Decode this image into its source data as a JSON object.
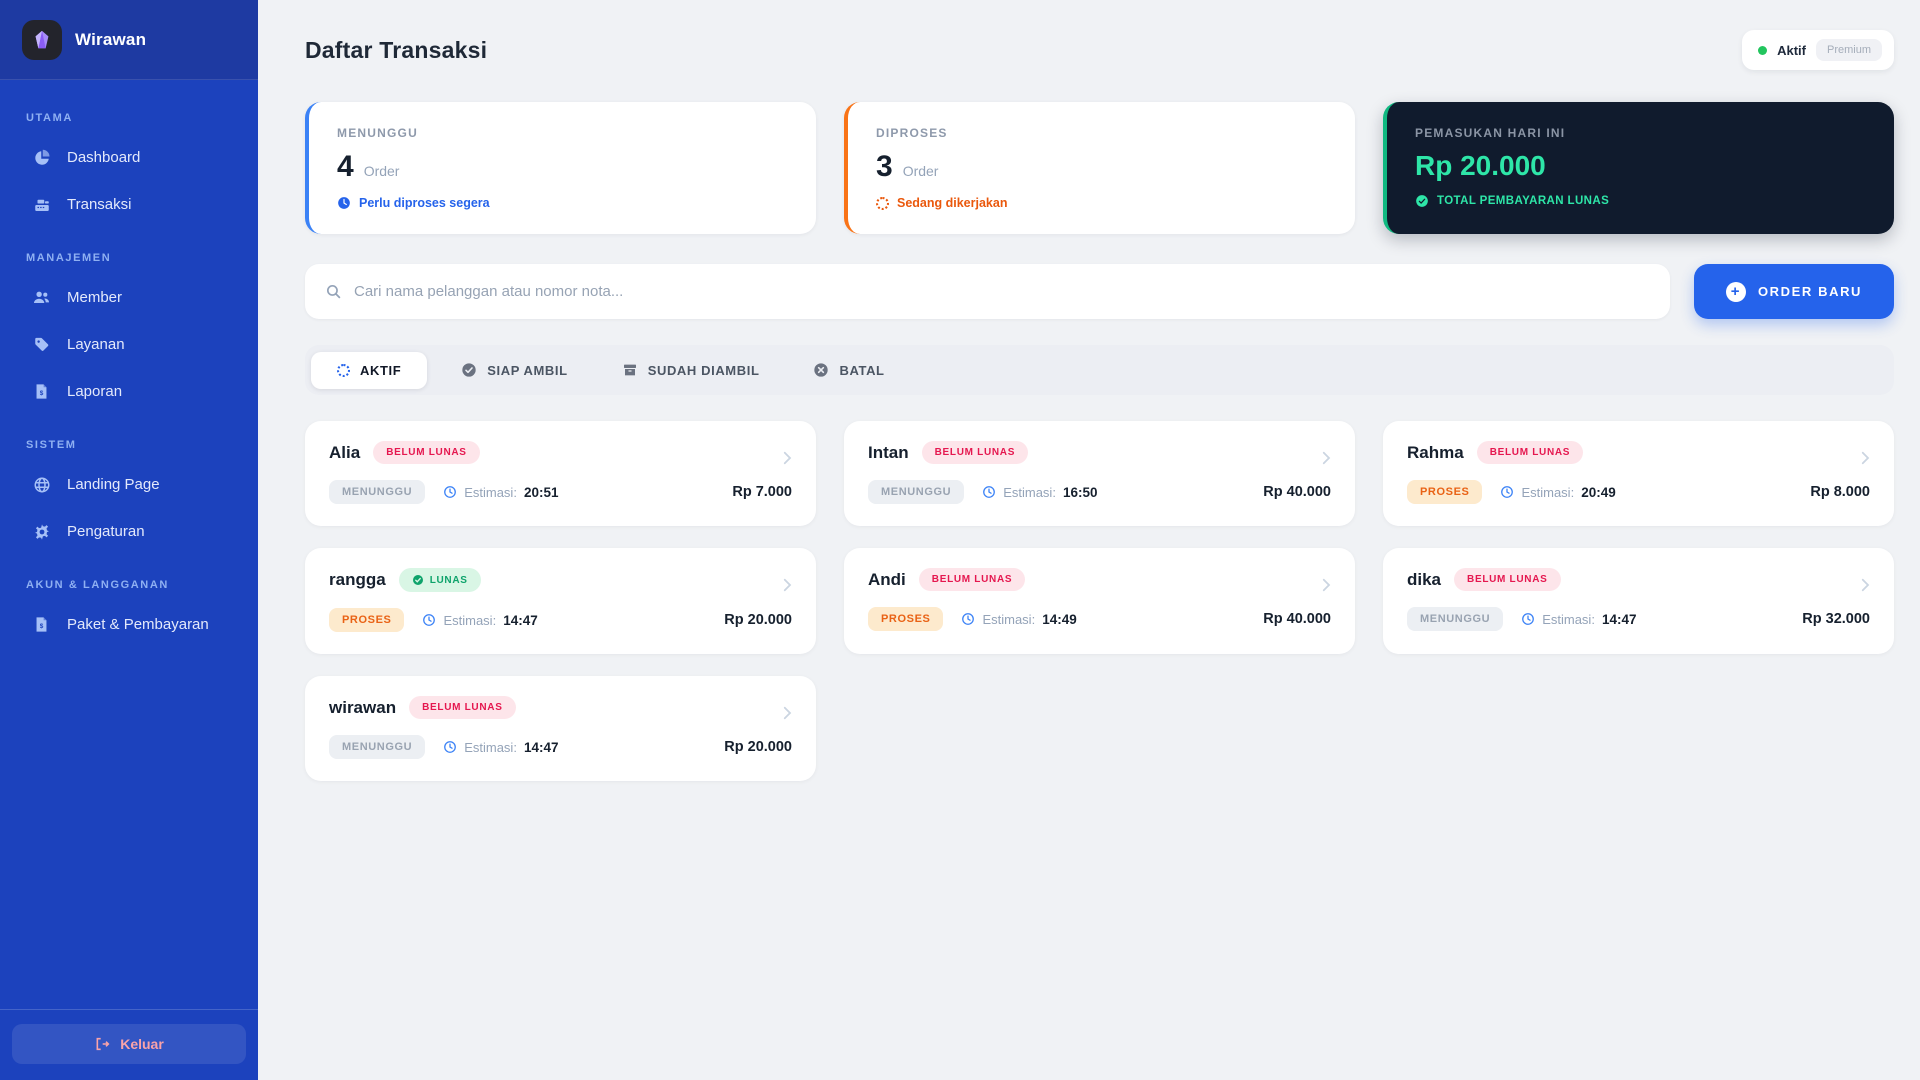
{
  "app": {
    "brand": "Wirawan"
  },
  "sidebar": {
    "sections": [
      {
        "label": "UTAMA",
        "items": [
          {
            "label": "Dashboard",
            "icon": "pie-chart-icon"
          },
          {
            "label": "Transaksi",
            "icon": "cash-register-icon"
          }
        ]
      },
      {
        "label": "MANAJEMEN",
        "items": [
          {
            "label": "Member",
            "icon": "users-icon"
          },
          {
            "label": "Layanan",
            "icon": "tags-icon"
          },
          {
            "label": "Laporan",
            "icon": "receipt-icon"
          }
        ]
      },
      {
        "label": "SISTEM",
        "items": [
          {
            "label": "Landing Page",
            "icon": "globe-icon"
          },
          {
            "label": "Pengaturan",
            "icon": "gear-icon"
          }
        ]
      },
      {
        "label": "AKUN & LANGGANAN",
        "items": [
          {
            "label": "Paket & Pembayaran",
            "icon": "receipt-icon"
          }
        ]
      }
    ],
    "logout_label": "Keluar"
  },
  "header": {
    "title": "Daftar Transaksi",
    "account_status": "Aktif",
    "plan": "Premium"
  },
  "stats": [
    {
      "title": "MENUNGGU",
      "value": "4",
      "unit": "Order",
      "note": "Perlu diproses segera",
      "accent": "#3b82f6",
      "note_icon": "clock-icon"
    },
    {
      "title": "DIPROSES",
      "value": "3",
      "unit": "Order",
      "note": "Sedang dikerjakan",
      "accent": "#f97316",
      "note_icon": "spinner-icon"
    },
    {
      "title": "PEMASUKAN HARI INI",
      "value": "Rp 20.000",
      "note": "TOTAL PEMBAYARAN LUNAS",
      "accent": "#10b981",
      "note_icon": "check-circle-icon"
    }
  ],
  "search": {
    "placeholder": "Cari nama pelanggan atau nomor nota..."
  },
  "actions": {
    "new_order": "ORDER BARU"
  },
  "tabs": [
    {
      "label": "AKTIF",
      "icon": "spinner-icon",
      "active": true
    },
    {
      "label": "SIAP AMBIL",
      "icon": "check-circle-icon",
      "active": false
    },
    {
      "label": "SUDAH DIAMBIL",
      "icon": "box-icon",
      "active": false
    },
    {
      "label": "BATAL",
      "icon": "x-circle-icon",
      "active": false
    }
  ],
  "labels": {
    "estimasi": "Estimasi:"
  },
  "transactions": [
    {
      "name": "Alia",
      "payment": "BELUM LUNAS",
      "status": "MENUNGGU",
      "estimasi": "20:51",
      "amount": "Rp 7.000"
    },
    {
      "name": "Intan",
      "payment": "BELUM LUNAS",
      "status": "MENUNGGU",
      "estimasi": "16:50",
      "amount": "Rp 40.000"
    },
    {
      "name": "Rahma",
      "payment": "BELUM LUNAS",
      "status": "PROSES",
      "estimasi": "20:49",
      "amount": "Rp 8.000"
    },
    {
      "name": "rangga",
      "payment": "LUNAS",
      "status": "PROSES",
      "estimasi": "14:47",
      "amount": "Rp 20.000"
    },
    {
      "name": "Andi",
      "payment": "BELUM LUNAS",
      "status": "PROSES",
      "estimasi": "14:49",
      "amount": "Rp 40.000"
    },
    {
      "name": "dika",
      "payment": "BELUM LUNAS",
      "status": "MENUNGGU",
      "estimasi": "14:47",
      "amount": "Rp 32.000"
    },
    {
      "name": "wirawan",
      "payment": "BELUM LUNAS",
      "status": "MENUNGGU",
      "estimasi": "14:47",
      "amount": "Rp 20.000"
    }
  ],
  "colors": {
    "sidebar_bg": "#1c42bd",
    "sidebar_header_bg": "#1e3aa2",
    "accent_blue": "#3b82f6",
    "accent_orange": "#f97316",
    "accent_green": "#10b981",
    "primary_button": "#2563eb",
    "income_green": "#2ee6a8",
    "dark_card": "#101b2d",
    "unpaid_red": "#e5174f",
    "paid_green": "#0ea36b",
    "logout_pink": "#f9a3a9",
    "page_bg": "#f0f2f5"
  }
}
